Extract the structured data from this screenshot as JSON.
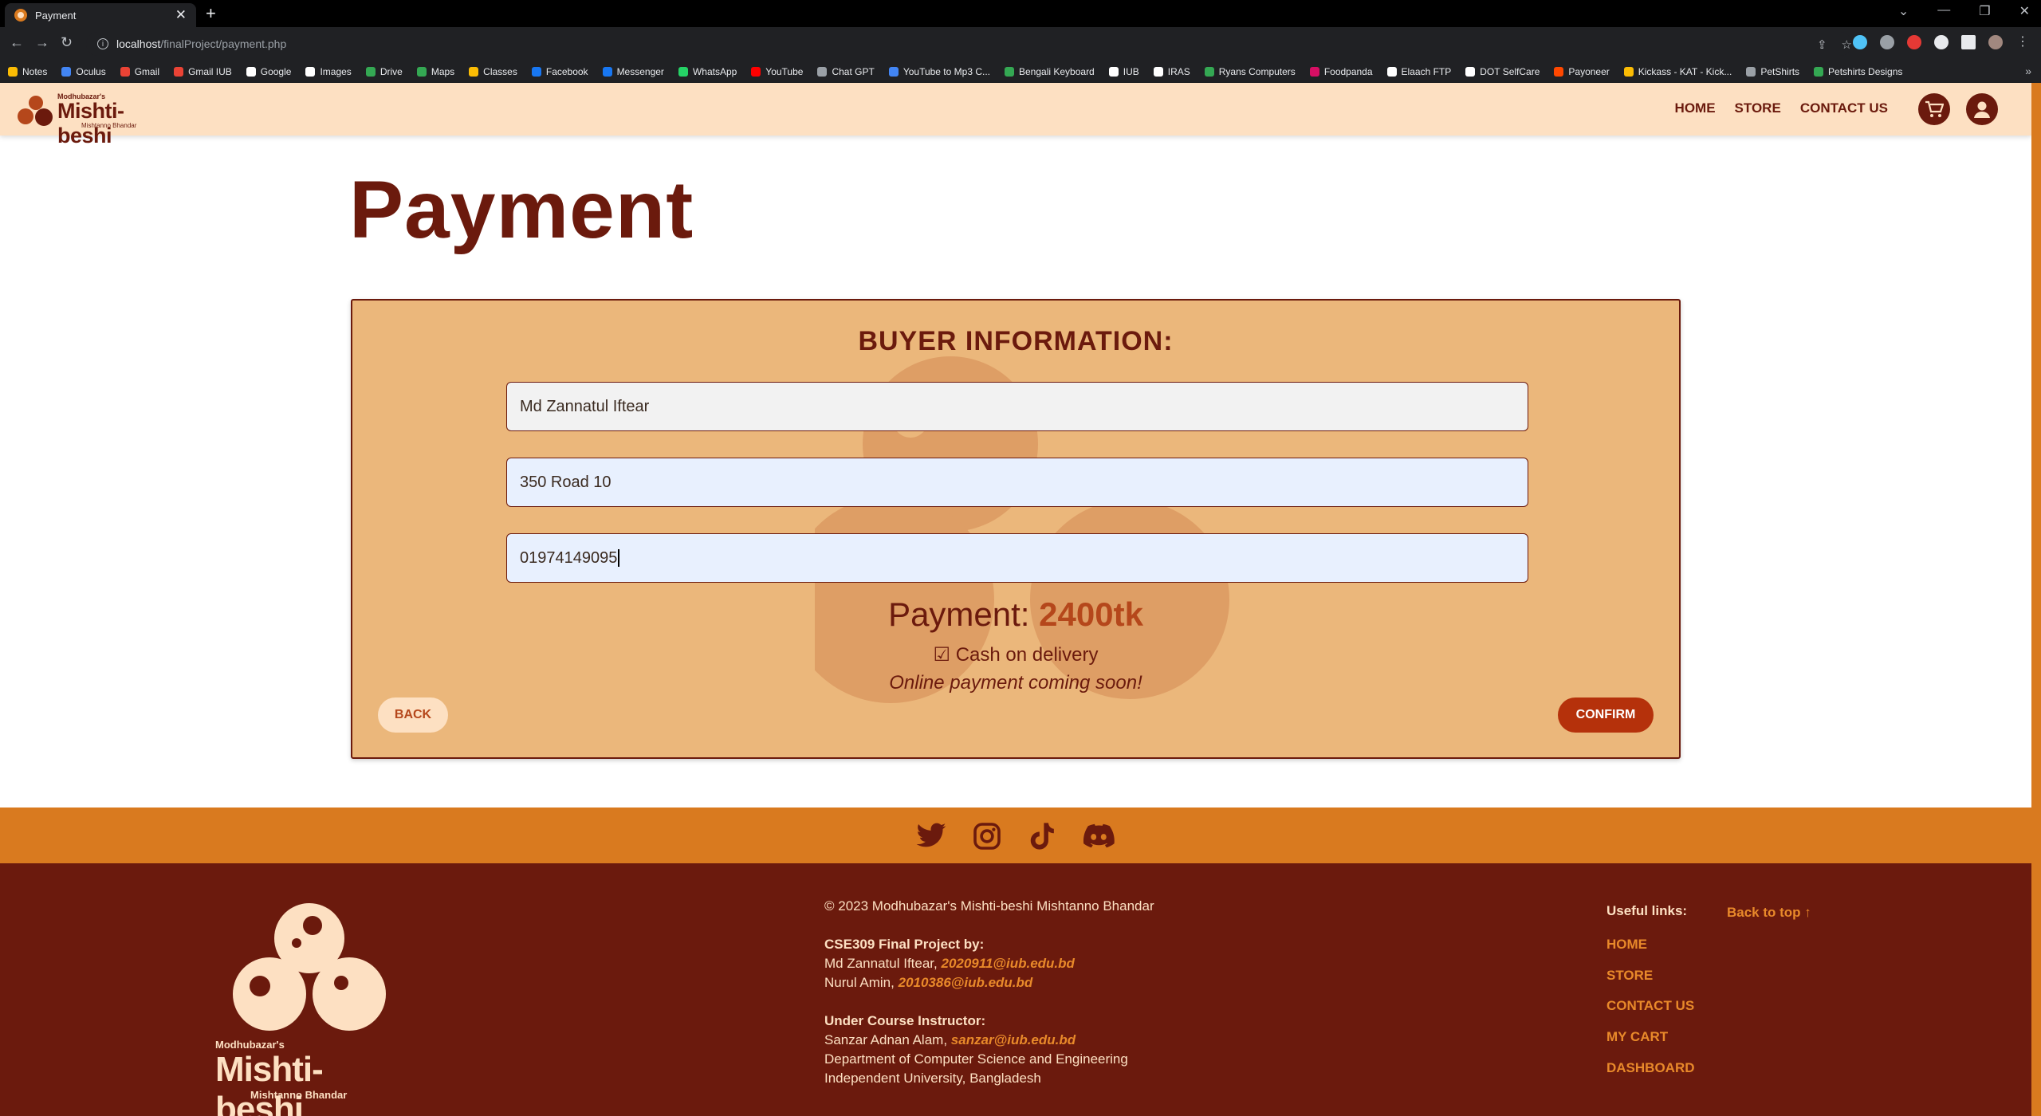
{
  "browser": {
    "tab_title": "Payment",
    "tab_close": "✕",
    "new_tab": "+",
    "url_host": "localhost",
    "url_path": "/finalProject/payment.php",
    "window_controls": [
      "⌄",
      "—",
      "❐",
      "✕"
    ],
    "bookmarks": [
      {
        "label": "Notes",
        "color": "#fbbc04"
      },
      {
        "label": "Oculus",
        "color": "#4285f4"
      },
      {
        "label": "Gmail",
        "color": "#ea4335"
      },
      {
        "label": "Gmail IUB",
        "color": "#ea4335"
      },
      {
        "label": "Google",
        "color": "#ffffff"
      },
      {
        "label": "Images",
        "color": "#ffffff"
      },
      {
        "label": "Drive",
        "color": "#34a853"
      },
      {
        "label": "Maps",
        "color": "#34a853"
      },
      {
        "label": "Classes",
        "color": "#fbbc04"
      },
      {
        "label": "Facebook",
        "color": "#1877f2"
      },
      {
        "label": "Messenger",
        "color": "#1877f2"
      },
      {
        "label": "WhatsApp",
        "color": "#25d366"
      },
      {
        "label": "YouTube",
        "color": "#ff0000"
      },
      {
        "label": "Chat GPT",
        "color": "#9aa0a6"
      },
      {
        "label": "YouTube to Mp3 C...",
        "color": "#4285f4"
      },
      {
        "label": "Bengali Keyboard",
        "color": "#34a853"
      },
      {
        "label": "IUB",
        "color": "#ffffff"
      },
      {
        "label": "IRAS",
        "color": "#ffffff"
      },
      {
        "label": "Ryans Computers",
        "color": "#34a853"
      },
      {
        "label": "Foodpanda",
        "color": "#d70f64"
      },
      {
        "label": "Elaach FTP",
        "color": "#ffffff"
      },
      {
        "label": "DOT SelfCare",
        "color": "#ffffff"
      },
      {
        "label": "Payoneer",
        "color": "#ff4800"
      },
      {
        "label": "Kickass - KAT - Kick...",
        "color": "#fbbc04"
      },
      {
        "label": "PetShirts",
        "color": "#9aa0a6"
      },
      {
        "label": "Petshirts Designs",
        "color": "#34a853"
      }
    ],
    "bookmarks_more": "»"
  },
  "header": {
    "logo_small": "Modhubazar's",
    "logo_big": "Mishti-beshi",
    "logo_tiny": "Mishtanno Bhandar",
    "nav": [
      "HOME",
      "STORE",
      "CONTACT US"
    ]
  },
  "page": {
    "title": "Payment"
  },
  "form": {
    "title": "BUYER INFORMATION:",
    "name_value": "Md Zannatul Iftear",
    "address_value": "350 Road 10",
    "phone_value": "01974149095",
    "payment_label": "Payment:",
    "payment_amount": "2400tk",
    "cod_label": "☑ Cash on delivery",
    "online_note": "Online payment coming soon!",
    "back_label": "BACK",
    "confirm_label": "CONFIRM"
  },
  "footer": {
    "logo_small": "Modhubazar's",
    "logo_big": "Mishti-beshi",
    "logo_tiny": "Mishtanno Bhandar",
    "copyright": "© 2023 Modhubazar's Mishti-beshi Mishtanno Bhandar",
    "project_title": "CSE309 Final Project by:",
    "member1_name": "Md Zannatul Iftear,",
    "member1_email": "2020911@iub.edu.bd",
    "member2_name": "Nurul Amin,",
    "member2_email": "2010386@iub.edu.bd",
    "instructor_title": "Under Course Instructor:",
    "instructor_name": "Sanzar Adnan Alam,",
    "instructor_email": "sanzar@iub.edu.bd",
    "dept": "Department of Computer Science and Engineering",
    "university": "Independent University, Bangladesh",
    "links_title": "Useful links:",
    "back_to_top": "Back to top ↑",
    "links": [
      "HOME",
      "STORE",
      "CONTACT US",
      "MY CART",
      "DASHBOARD"
    ]
  },
  "colors": {
    "brand_dark": "#6b1a0d",
    "brand_orange": "#d97a1f",
    "brand_cream": "#fde0c2",
    "card_bg": "#ebb77b",
    "accent": "#b5471b"
  }
}
